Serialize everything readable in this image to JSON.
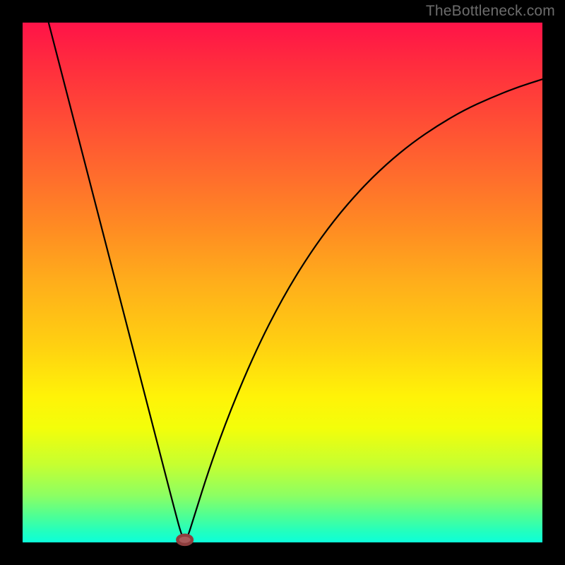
{
  "watermark": "TheBottleneck.com",
  "chart_data": {
    "type": "line",
    "title": "",
    "xlabel": "",
    "ylabel": "",
    "xlim": [
      0,
      100
    ],
    "ylim": [
      0,
      100
    ],
    "grid": false,
    "legend": false,
    "background": "gradient-red-to-green",
    "series": [
      {
        "name": "curve",
        "x": [
          5,
          8,
          11,
          14,
          17,
          20,
          23,
          26,
          29,
          30.8,
          31.6,
          33,
          36,
          40,
          45,
          50,
          55,
          60,
          65,
          70,
          75,
          80,
          85,
          90,
          95,
          100
        ],
        "y": [
          100,
          88.4,
          76.8,
          65.2,
          53.6,
          42.0,
          30.4,
          18.8,
          7.2,
          0.5,
          0.5,
          5.0,
          14.5,
          25.5,
          37.2,
          47.0,
          55.2,
          62.1,
          67.9,
          72.8,
          76.9,
          80.3,
          83.2,
          85.5,
          87.5,
          89.1
        ]
      }
    ],
    "marker": {
      "x": 31.2,
      "y": 0.5,
      "rx": 1.4,
      "ry": 0.9
    }
  }
}
